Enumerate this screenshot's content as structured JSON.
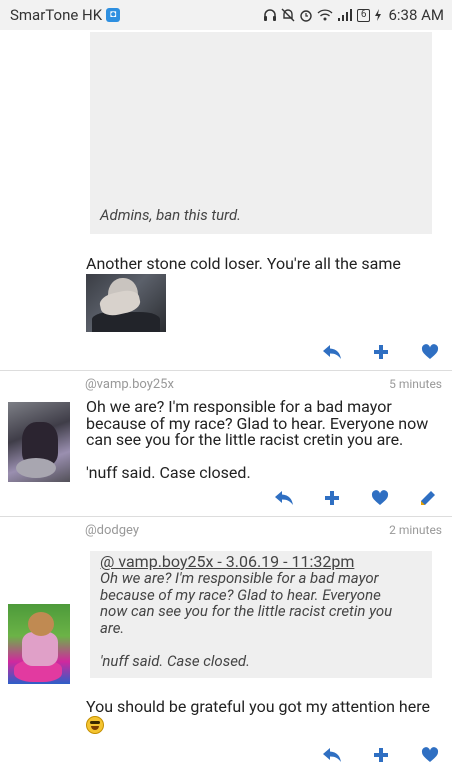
{
  "status_bar": {
    "carrier": "SmarTone HK",
    "carrier_badge_icon": "shield-badge-icon",
    "battery_level": "6",
    "time": "6:38 AM"
  },
  "post_top": {
    "quote_text": "Admins, ban this turd.",
    "message": "Another stone cold loser. You're all the same",
    "image_alt": "facepalm photo"
  },
  "comments": [
    {
      "handle": "@vamp.boy25x",
      "time_ago": "5 minutes",
      "lines": [
        "Oh we are? I'm responsible for a bad mayor",
        "because of my race? Glad to hear. Everyone now",
        "can see you for the little racist cretin you are.",
        "",
        "'nuff said. Case closed."
      ]
    },
    {
      "handle": "@dodgey",
      "time_ago": "2 minutes",
      "quote_link": "@ vamp.boy25x - 3.06.19 - 11:32pm",
      "quote_lines": [
        "Oh we are? I'm responsible for a bad mayor",
        "because of my race? Glad to hear. Everyone",
        "now can see you for the little racist cretin you",
        "are.",
        "",
        "'nuff said. Case closed."
      ],
      "message": "You should be grateful you got my attention here"
    }
  ],
  "colors": {
    "accent": "#2f6fc2",
    "divider": "#dddddd",
    "quote_bg": "#efefef"
  },
  "icons": {
    "reply": "reply-icon",
    "add": "plus-icon",
    "like": "heart-icon",
    "edit": "pencil-icon"
  }
}
